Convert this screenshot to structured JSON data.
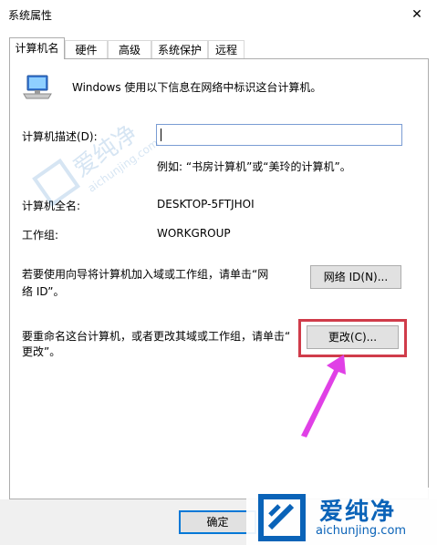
{
  "window": {
    "title": "系统属性",
    "close_glyph": "✕"
  },
  "tabs": [
    {
      "label": "计算机名",
      "active": true
    },
    {
      "label": "硬件",
      "active": false
    },
    {
      "label": "高级",
      "active": false
    },
    {
      "label": "系统保护",
      "active": false
    },
    {
      "label": "远程",
      "active": false
    }
  ],
  "panel": {
    "intro_text": "Windows 使用以下信息在网络中标识这台计算机。",
    "description_label": "计算机描述(D):",
    "description_value": "",
    "example_text": "例如: “书房计算机”或“美玲的计算机”。",
    "full_name_label": "计算机全名:",
    "full_name_value": "DESKTOP-5FTJHOI",
    "workgroup_label": "工作组:",
    "workgroup_value": "WORKGROUP",
    "network_id_text_line1": "若要使用向导将计算机加入域或工作组，请单击“网",
    "network_id_text_line2": "络 ID”。",
    "network_id_button": "网络 ID(N)...",
    "rename_text_line1": "要重命名这台计算机，或者更改其域或工作组，请单击“",
    "rename_text_line2": "更改”。",
    "change_button": "更改(C)..."
  },
  "footer": {
    "ok_button": "确定"
  },
  "watermark": {
    "brand": "爱纯净",
    "url": "aichunjing.com",
    "faint_brand": "爱纯净",
    "faint_url": "aichunjing.com"
  },
  "colors": {
    "highlight_border": "#d03c4a",
    "annotation_arrow": "#e040e6",
    "brand_blue": "#0a63b8",
    "focus_blue": "#0078d7"
  }
}
